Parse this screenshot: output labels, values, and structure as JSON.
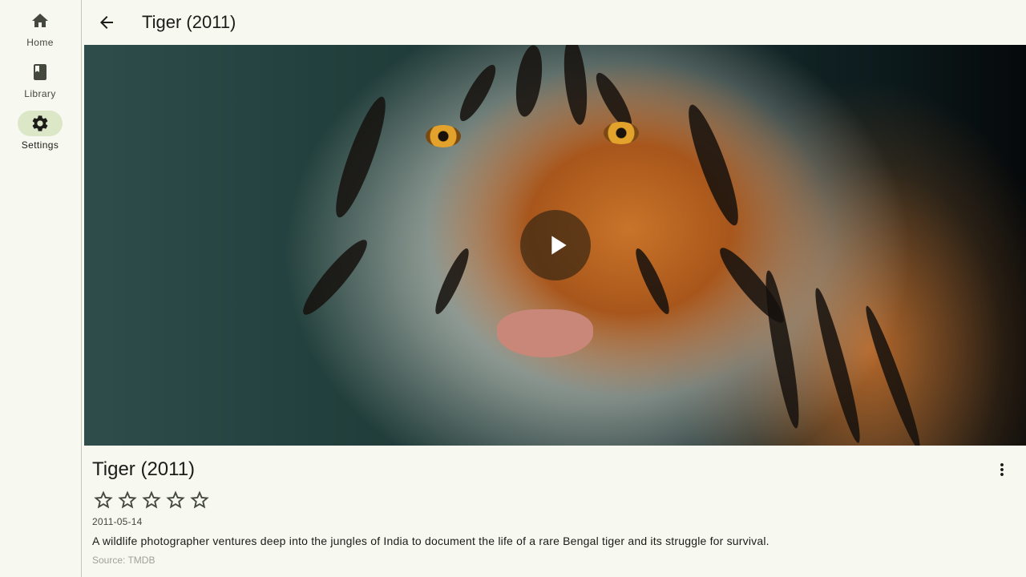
{
  "nav": {
    "items": [
      {
        "label": "Home",
        "icon": "home-icon",
        "active": false
      },
      {
        "label": "Library",
        "icon": "book-icon",
        "active": false
      },
      {
        "label": "Settings",
        "icon": "gear-icon",
        "active": true
      }
    ]
  },
  "topbar": {
    "title": "Tiger (2011)",
    "back_icon": "arrow-back-icon"
  },
  "backdrop": {
    "subject": "tiger",
    "play_icon": "play-icon"
  },
  "details": {
    "title": "Tiger (2011)",
    "rating": 0,
    "rating_max": 5,
    "release_date": "2011-05-14",
    "overview": "A wildlife photographer ventures deep into the jungles of India to document the life of a rare Bengal tiger and its struggle for survival.",
    "source": "Source: TMDB",
    "more_icon": "more-vert-icon"
  },
  "colors": {
    "background": "#f7f8f0",
    "active_indicator": "#dce7c8",
    "on_surface": "#1b1c18",
    "on_surface_variant": "#44483d"
  }
}
